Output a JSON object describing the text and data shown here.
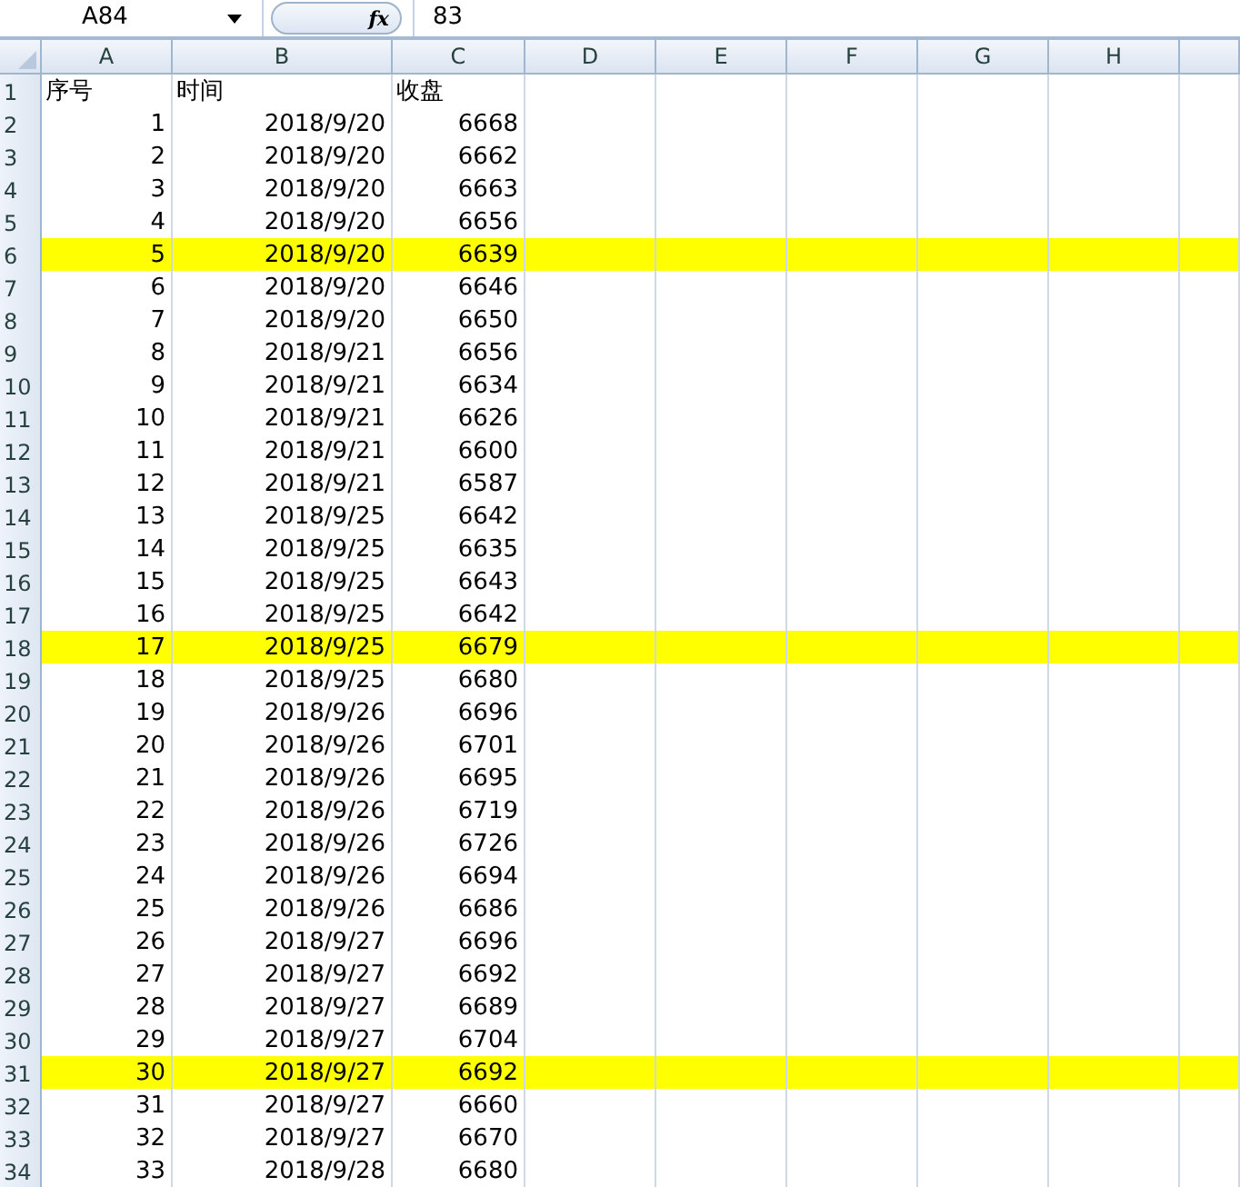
{
  "formula_bar": {
    "name_box": "A84",
    "function_symbol": "fx",
    "formula": "83"
  },
  "columns": [
    "A",
    "B",
    "C",
    "D",
    "E",
    "F",
    "G",
    "H"
  ],
  "rows": [
    {
      "number": "1",
      "kind": "header",
      "cells": [
        "序号",
        "时间",
        "收盘"
      ],
      "highlighted": false
    },
    {
      "number": "2",
      "kind": "data",
      "cells": [
        "1",
        "2018/9/20",
        "6668"
      ],
      "highlighted": false
    },
    {
      "number": "3",
      "kind": "data",
      "cells": [
        "2",
        "2018/9/20",
        "6662"
      ],
      "highlighted": false
    },
    {
      "number": "4",
      "kind": "data",
      "cells": [
        "3",
        "2018/9/20",
        "6663"
      ],
      "highlighted": false
    },
    {
      "number": "5",
      "kind": "data",
      "cells": [
        "4",
        "2018/9/20",
        "6656"
      ],
      "highlighted": false
    },
    {
      "number": "6",
      "kind": "data",
      "cells": [
        "5",
        "2018/9/20",
        "6639"
      ],
      "highlighted": true
    },
    {
      "number": "7",
      "kind": "data",
      "cells": [
        "6",
        "2018/9/20",
        "6646"
      ],
      "highlighted": false
    },
    {
      "number": "8",
      "kind": "data",
      "cells": [
        "7",
        "2018/9/20",
        "6650"
      ],
      "highlighted": false
    },
    {
      "number": "9",
      "kind": "data",
      "cells": [
        "8",
        "2018/9/21",
        "6656"
      ],
      "highlighted": false
    },
    {
      "number": "10",
      "kind": "data",
      "cells": [
        "9",
        "2018/9/21",
        "6634"
      ],
      "highlighted": false
    },
    {
      "number": "11",
      "kind": "data",
      "cells": [
        "10",
        "2018/9/21",
        "6626"
      ],
      "highlighted": false
    },
    {
      "number": "12",
      "kind": "data",
      "cells": [
        "11",
        "2018/9/21",
        "6600"
      ],
      "highlighted": false
    },
    {
      "number": "13",
      "kind": "data",
      "cells": [
        "12",
        "2018/9/21",
        "6587"
      ],
      "highlighted": false
    },
    {
      "number": "14",
      "kind": "data",
      "cells": [
        "13",
        "2018/9/25",
        "6642"
      ],
      "highlighted": false
    },
    {
      "number": "15",
      "kind": "data",
      "cells": [
        "14",
        "2018/9/25",
        "6635"
      ],
      "highlighted": false
    },
    {
      "number": "16",
      "kind": "data",
      "cells": [
        "15",
        "2018/9/25",
        "6643"
      ],
      "highlighted": false
    },
    {
      "number": "17",
      "kind": "data",
      "cells": [
        "16",
        "2018/9/25",
        "6642"
      ],
      "highlighted": false
    },
    {
      "number": "18",
      "kind": "data",
      "cells": [
        "17",
        "2018/9/25",
        "6679"
      ],
      "highlighted": true
    },
    {
      "number": "19",
      "kind": "data",
      "cells": [
        "18",
        "2018/9/25",
        "6680"
      ],
      "highlighted": false
    },
    {
      "number": "20",
      "kind": "data",
      "cells": [
        "19",
        "2018/9/26",
        "6696"
      ],
      "highlighted": false
    },
    {
      "number": "21",
      "kind": "data",
      "cells": [
        "20",
        "2018/9/26",
        "6701"
      ],
      "highlighted": false
    },
    {
      "number": "22",
      "kind": "data",
      "cells": [
        "21",
        "2018/9/26",
        "6695"
      ],
      "highlighted": false
    },
    {
      "number": "23",
      "kind": "data",
      "cells": [
        "22",
        "2018/9/26",
        "6719"
      ],
      "highlighted": false
    },
    {
      "number": "24",
      "kind": "data",
      "cells": [
        "23",
        "2018/9/26",
        "6726"
      ],
      "highlighted": false
    },
    {
      "number": "25",
      "kind": "data",
      "cells": [
        "24",
        "2018/9/26",
        "6694"
      ],
      "highlighted": false
    },
    {
      "number": "26",
      "kind": "data",
      "cells": [
        "25",
        "2018/9/26",
        "6686"
      ],
      "highlighted": false
    },
    {
      "number": "27",
      "kind": "data",
      "cells": [
        "26",
        "2018/9/27",
        "6696"
      ],
      "highlighted": false
    },
    {
      "number": "28",
      "kind": "data",
      "cells": [
        "27",
        "2018/9/27",
        "6692"
      ],
      "highlighted": false
    },
    {
      "number": "29",
      "kind": "data",
      "cells": [
        "28",
        "2018/9/27",
        "6689"
      ],
      "highlighted": false
    },
    {
      "number": "30",
      "kind": "data",
      "cells": [
        "29",
        "2018/9/27",
        "6704"
      ],
      "highlighted": false
    },
    {
      "number": "31",
      "kind": "data",
      "cells": [
        "30",
        "2018/9/27",
        "6692"
      ],
      "highlighted": true
    },
    {
      "number": "32",
      "kind": "data",
      "cells": [
        "31",
        "2018/9/27",
        "6660"
      ],
      "highlighted": false
    },
    {
      "number": "33",
      "kind": "data",
      "cells": [
        "32",
        "2018/9/27",
        "6670"
      ],
      "highlighted": false
    },
    {
      "number": "34",
      "kind": "data",
      "cells": [
        "33",
        "2018/9/28",
        "6680"
      ],
      "highlighted": false
    }
  ]
}
